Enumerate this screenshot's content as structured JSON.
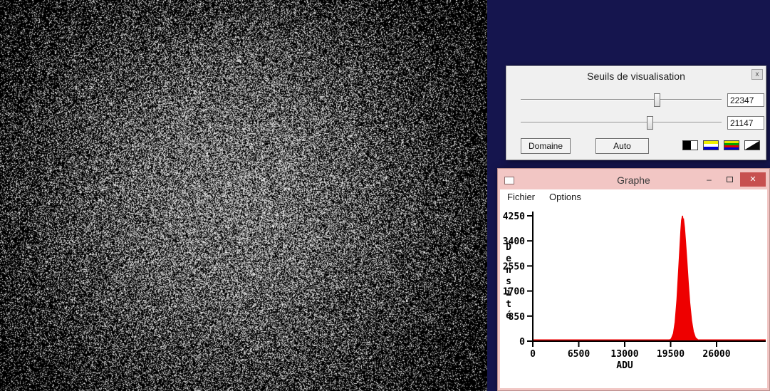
{
  "desktop": {
    "background": "#15154e"
  },
  "noise_image": {
    "center_x": 330,
    "center_y": 278,
    "sigma": 235,
    "base_density": 0.015,
    "peak_density": 0.6,
    "min_gray": 110,
    "max_gray": 255
  },
  "threshold_dialog": {
    "title": "Seuils de visualisation",
    "close_glyph": "x",
    "high_slider": {
      "value": "22347",
      "fraction": 0.682
    },
    "low_slider": {
      "value": "21147",
      "fraction": 0.645
    },
    "domaine_button": "Domaine",
    "auto_button": "Auto",
    "palette_icons": [
      "black-white",
      "yellow-blue",
      "multicolor",
      "ramp"
    ]
  },
  "graph_window": {
    "title": "Graphe",
    "minimize_glyph": "–",
    "close_glyph": "✕",
    "menu": [
      "Fichier",
      "Options"
    ]
  },
  "chart_data": {
    "type": "area",
    "xlabel": "ADU",
    "ylabel": "Densité",
    "x_ticks": [
      0,
      6500,
      13000,
      19500,
      26000
    ],
    "y_ticks": [
      0,
      850,
      1700,
      2550,
      3400,
      4250
    ],
    "xlim": [
      0,
      30500
    ],
    "ylim": [
      0,
      4450
    ],
    "series_color": "#ee0000",
    "legend": false,
    "grid": false,
    "points": [
      [
        0,
        0
      ],
      [
        18600,
        0
      ],
      [
        19200,
        20
      ],
      [
        19600,
        80
      ],
      [
        19900,
        260
      ],
      [
        20150,
        650
      ],
      [
        20400,
        1400
      ],
      [
        20600,
        2250
      ],
      [
        20800,
        3100
      ],
      [
        20950,
        3750
      ],
      [
        21050,
        4100
      ],
      [
        21120,
        4180
      ],
      [
        21180,
        4250
      ],
      [
        21240,
        4090
      ],
      [
        21300,
        4160
      ],
      [
        21450,
        3850
      ],
      [
        21600,
        3400
      ],
      [
        21800,
        2700
      ],
      [
        22000,
        1950
      ],
      [
        22200,
        1300
      ],
      [
        22450,
        700
      ],
      [
        22700,
        330
      ],
      [
        23000,
        120
      ],
      [
        23400,
        35
      ],
      [
        23900,
        8
      ],
      [
        24500,
        0
      ],
      [
        30500,
        0
      ]
    ]
  }
}
